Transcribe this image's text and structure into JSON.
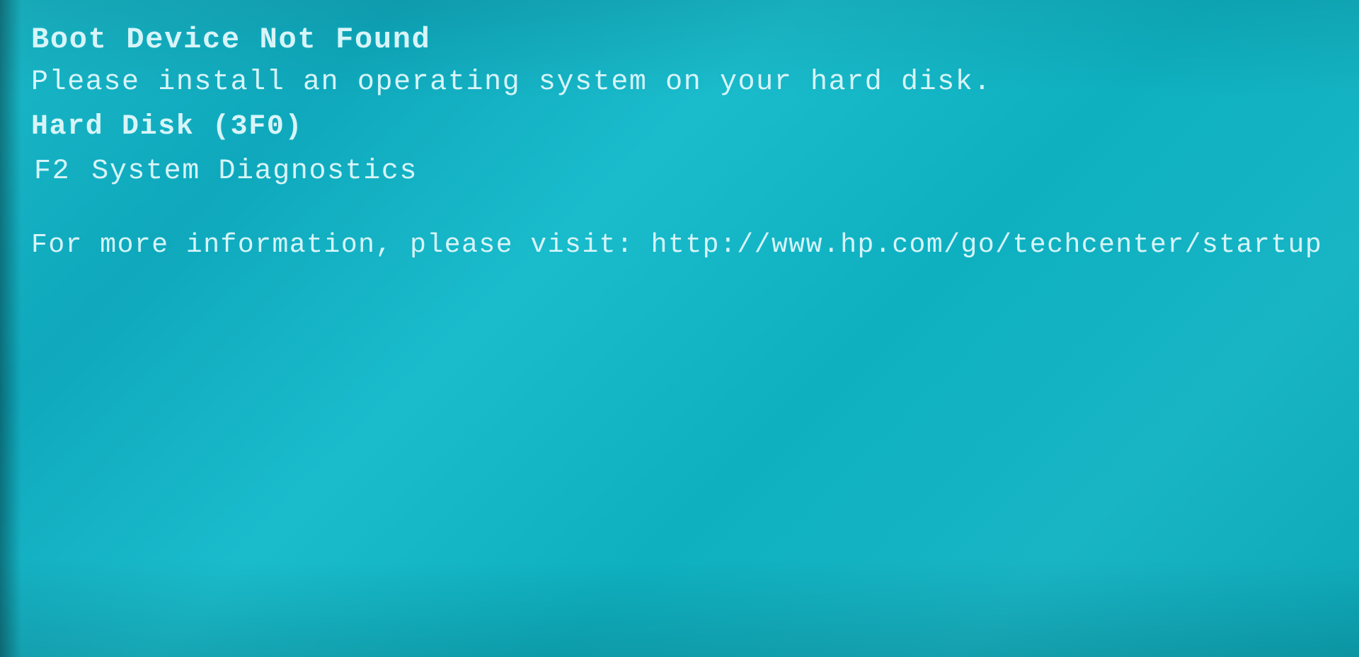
{
  "screen": {
    "title": "Boot Device Not Found",
    "install_message": "Please install an operating system on your hard disk.",
    "hard_disk_label": "Hard Disk (3F0)",
    "f2_key": "F2",
    "f2_description": "System Diagnostics",
    "more_info_label": "For more information, please visit:",
    "more_info_url": "http://www.hp.com/go/techcenter/startup",
    "background_color": "#1ab8c8",
    "text_color": "#d8f4f8"
  }
}
